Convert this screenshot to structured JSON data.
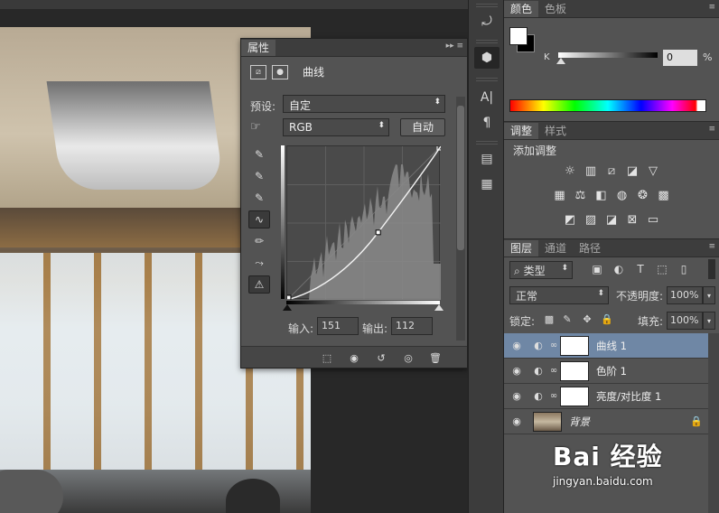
{
  "properties": {
    "tab_label": "属性",
    "title": "曲线",
    "preset_label": "预设:",
    "preset_value": "自定",
    "channel_value": "RGB",
    "auto_label": "自动",
    "input_label": "输入:",
    "input_value": "151",
    "output_label": "输出:",
    "output_value": "112"
  },
  "color": {
    "tabs": [
      "颜色",
      "色板"
    ],
    "k_label": "K",
    "k_value": "0",
    "k_unit": "%"
  },
  "adjustments": {
    "tabs": [
      "调整",
      "样式"
    ],
    "title": "添加调整"
  },
  "layers": {
    "tabs": [
      "图层",
      "通道",
      "路径"
    ],
    "filter_value": "类型",
    "blend_value": "正常",
    "opacity_label": "不透明度:",
    "opacity_value": "100%",
    "lock_label": "锁定:",
    "fill_label": "填充:",
    "fill_value": "100%",
    "rows": [
      {
        "name": "曲线 1"
      },
      {
        "name": "色阶 1"
      },
      {
        "name": "亮度/对比度 1"
      },
      {
        "name": "背景"
      }
    ]
  },
  "curve": {
    "input": 151,
    "output": 112
  },
  "watermark": {
    "logo": "Bai 经验",
    "url": "jingyan.baidu.com"
  }
}
